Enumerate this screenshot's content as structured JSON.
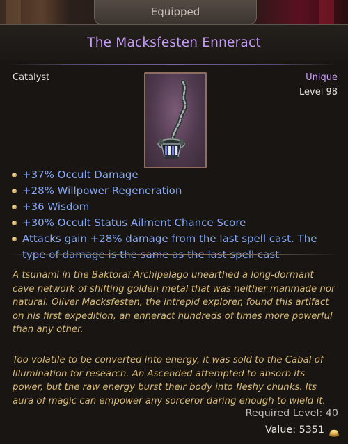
{
  "tab": {
    "label": "Equipped"
  },
  "item": {
    "name": "The Macksfesten Enneract",
    "type": "Catalyst",
    "rarity": "Unique",
    "level": "Level 98",
    "image_icon": "catalyst-enneract-icon"
  },
  "mods": [
    "+37% Occult Damage",
    "+28% Willpower Regeneration",
    "+36 Wisdom",
    "+30% Occult Status Ailment Chance Score",
    "Attacks gain +28% damage from the last spell cast. The type of damage is the same as the last spell cast"
  ],
  "description": [
    "A tsunami in the Baktoraï Archipelago unearthed a long-dormant cave network of shifting golden metal that was neither manmade nor natural. Oliver Macksfesten, the intrepid explorer, found this artifact on his first expedition, an enneract hundreds of times more powerful than any other.",
    "Too volatile to be converted into energy, it was sold to the Cabal of Illumination for research. An Ascended attempted to absorb its power, but the raw energy burst their body into fleshy chunks. Its aura of magic can empower any sorceror daring enough to wield it."
  ],
  "requirements": {
    "required_level": "Required Level: 40"
  },
  "value": {
    "label": "Value: 5351",
    "icon": "gold-coins-icon"
  },
  "colors": {
    "title": "#c69cf7",
    "mod": "#85a6f6",
    "flavor": "#d7b976",
    "rarity": "#c99ff6"
  }
}
